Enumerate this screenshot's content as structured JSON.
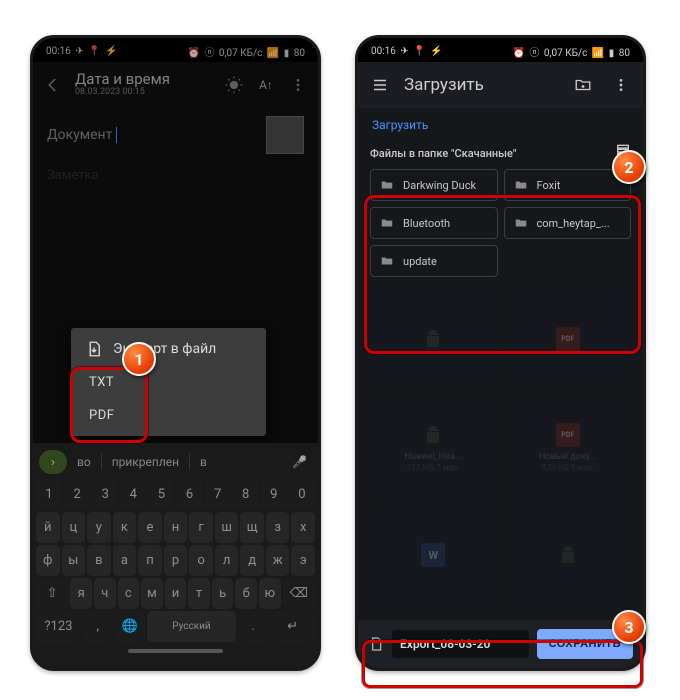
{
  "status": {
    "time": "00:16",
    "right": "0,07 КБ/с",
    "battery": "80"
  },
  "left": {
    "header": {
      "title": "Дата и время",
      "subtitle": "08.03.2023  00:15"
    },
    "document_label": "Документ",
    "note_placeholder": "Заметка",
    "popup": {
      "title": "Экспорт в файл",
      "options": [
        "TXT",
        "PDF"
      ]
    },
    "suggestions": [
      "во",
      "прикреплен",
      "в"
    ],
    "keyboard": {
      "row_num": [
        "1",
        "2",
        "3",
        "4",
        "5",
        "6",
        "7",
        "8",
        "9",
        "0"
      ],
      "row1": [
        "й",
        "ц",
        "у",
        "к",
        "е",
        "н",
        "г",
        "ш",
        "щ",
        "з",
        "х"
      ],
      "row2": [
        "ф",
        "ы",
        "в",
        "а",
        "п",
        "р",
        "о",
        "л",
        "д",
        "ж",
        "э"
      ],
      "row3_shift": "⇧",
      "row3": [
        "я",
        "ч",
        "с",
        "м",
        "и",
        "т",
        "ь",
        "б",
        "ю"
      ],
      "row3_back": "⌫",
      "row4": {
        "sym": "?123",
        "comma": ",",
        "lang": "🌐",
        "space": "Русский",
        "dot": ".",
        "enter": "↵"
      }
    }
  },
  "right": {
    "header_title": "Загрузить",
    "breadcrumb": "Загрузить",
    "section_title": "Файлы в папке \"Скачанные\"",
    "folders": [
      "Darkwing Duck",
      "Foxit",
      "Bluetooth",
      "com_heytap_...",
      "update"
    ],
    "files": [
      {
        "icon": "android",
        "name": "",
        "sub": ""
      },
      {
        "icon": "pdf",
        "name": "",
        "sub": ""
      },
      {
        "icon": "android",
        "name": "Huawei_Hea...",
        "sub": "122 МБ 7 мар."
      },
      {
        "icon": "pdf",
        "name": "Новый доку...",
        "sub": "8,29 КБ 5 мар."
      },
      {
        "icon": "word",
        "name": "",
        "sub": ""
      },
      {
        "icon": "android",
        "name": "",
        "sub": ""
      }
    ],
    "filename": "Export_08-03-20",
    "save_label": "СОХРАНИТЬ"
  },
  "badges": {
    "one": "1",
    "two": "2",
    "three": "3"
  }
}
